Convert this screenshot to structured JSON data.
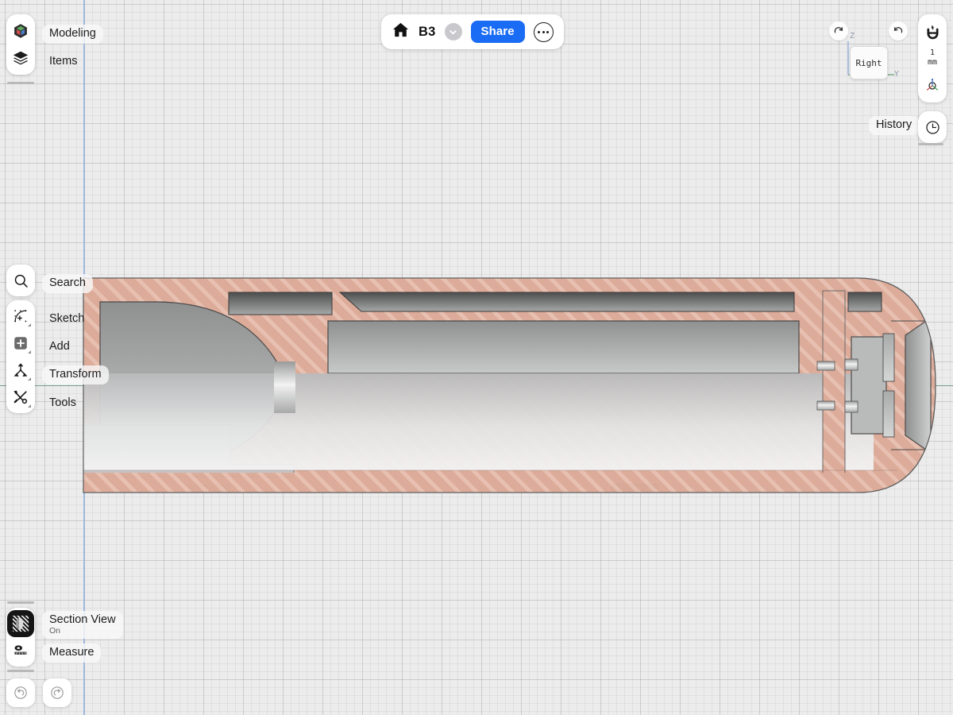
{
  "app": {
    "background_color": "#ececec",
    "accent_color": "#1a6cf5",
    "section_fill_color": "#dcab99",
    "axis_vertical_color": "#9db7de",
    "axis_horizontal_color": "#63937c"
  },
  "topbar": {
    "home_icon": "home-icon",
    "document_title": "B3",
    "chevron_icon": "chevron-down-icon",
    "share_label": "Share",
    "more_icon": "ellipsis-icon"
  },
  "navigation": {
    "redo_icon": "redo-arrow-icon",
    "undo_icon": "undo-arrow-icon",
    "viewcube_label": "Right",
    "axis_z_label": "Z",
    "axis_y_label": "Y"
  },
  "right_rail": {
    "snap_icon": "magnet-icon",
    "unit_value": "1",
    "unit_label": "mm",
    "orientation_icon": "axis-orientation-icon"
  },
  "history": {
    "label": "History",
    "icon": "clock-icon"
  },
  "left_top_panel": {
    "items": [
      {
        "label": "Modeling",
        "icon": "cube-icon",
        "active": true
      },
      {
        "label": "Items",
        "icon": "layers-icon",
        "active": false
      }
    ]
  },
  "left_tools_panel": {
    "search": {
      "label": "Search",
      "icon": "search-icon"
    },
    "items": [
      {
        "label": "Sketch",
        "icon": "sketch-curve-icon",
        "submenu": true
      },
      {
        "label": "Add",
        "icon": "add-plus-icon",
        "submenu": true
      },
      {
        "label": "Transform",
        "icon": "transform-arrows-icon",
        "submenu": true
      },
      {
        "label": "Tools",
        "icon": "wrench-screwdriver-icon",
        "submenu": true
      }
    ]
  },
  "left_bottom_panel": {
    "items": [
      {
        "label": "Section View",
        "state": "On",
        "icon": "section-view-icon",
        "active": true
      },
      {
        "label": "Measure",
        "state": "",
        "icon": "tape-measure-icon",
        "active": false
      }
    ]
  },
  "bottom_controls": {
    "undo_icon": "undo-circle-icon",
    "redo_icon": "redo-circle-icon"
  }
}
